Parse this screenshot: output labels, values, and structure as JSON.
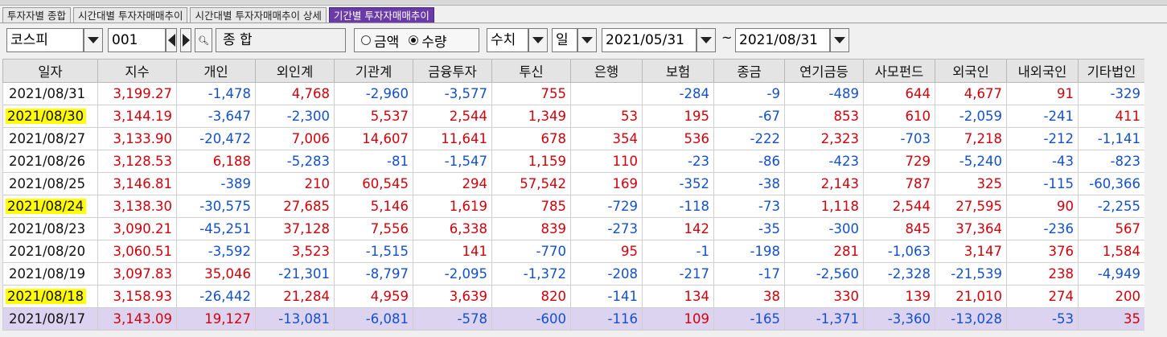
{
  "tabs": [
    {
      "label": "투자자별 종합",
      "active": false
    },
    {
      "label": "시간대별 투자자매매추이",
      "active": false
    },
    {
      "label": "시간대별 투자자매매추이 상세",
      "active": false
    },
    {
      "label": "기간별 투자자매매추이",
      "active": true
    }
  ],
  "controls": {
    "market": "코스피",
    "code": "001",
    "name": "종          합",
    "radio_amount": "금액",
    "radio_qty": "수량",
    "radio_selected": "수량",
    "value_type": "수치",
    "period": "일",
    "date_from": "2021/05/31",
    "tilde": "~",
    "date_to": "2021/08/31"
  },
  "colors": {
    "positive": "#d0000a",
    "negative": "#1450c8",
    "highlight": "#ffff00",
    "selected_row": "#dcd3f0",
    "active_tab": "#6a3aa6"
  },
  "table": {
    "headers": [
      "일자",
      "지수",
      "개인",
      "외인계",
      "기관계",
      "금융투자",
      "투신",
      "은행",
      "보험",
      "종금",
      "연기금등",
      "사모펀드",
      "외국인",
      "내외국인",
      "기타법인"
    ],
    "rows": [
      {
        "date": "2021/08/31",
        "hl": false,
        "sel": false,
        "cells": [
          "3,199.27",
          "-1,478",
          "4,768",
          "-2,960",
          "-3,577",
          "755",
          "",
          "-284",
          "-9",
          "-489",
          "644",
          "4,677",
          "91",
          "-329"
        ]
      },
      {
        "date": "2021/08/30",
        "hl": true,
        "sel": false,
        "cells": [
          "3,144.19",
          "-3,647",
          "-2,300",
          "5,537",
          "2,544",
          "1,349",
          "53",
          "195",
          "-67",
          "853",
          "610",
          "-2,059",
          "-241",
          "411"
        ]
      },
      {
        "date": "2021/08/27",
        "hl": false,
        "sel": false,
        "cells": [
          "3,133.90",
          "-20,472",
          "7,006",
          "14,607",
          "11,641",
          "678",
          "354",
          "536",
          "-222",
          "2,323",
          "-703",
          "7,218",
          "-212",
          "-1,141"
        ]
      },
      {
        "date": "2021/08/26",
        "hl": false,
        "sel": false,
        "cells": [
          "3,128.53",
          "6,188",
          "-5,283",
          "-81",
          "-1,547",
          "1,159",
          "110",
          "-23",
          "-86",
          "-423",
          "729",
          "-5,240",
          "-43",
          "-823"
        ]
      },
      {
        "date": "2021/08/25",
        "hl": false,
        "sel": false,
        "cells": [
          "3,146.81",
          "-389",
          "210",
          "60,545",
          "294",
          "57,542",
          "169",
          "-352",
          "-38",
          "2,143",
          "787",
          "325",
          "-115",
          "-60,366"
        ]
      },
      {
        "date": "2021/08/24",
        "hl": true,
        "sel": false,
        "cells": [
          "3,138.30",
          "-30,575",
          "27,685",
          "5,146",
          "1,619",
          "785",
          "-729",
          "-118",
          "-73",
          "1,118",
          "2,544",
          "27,595",
          "90",
          "-2,255"
        ]
      },
      {
        "date": "2021/08/23",
        "hl": false,
        "sel": false,
        "cells": [
          "3,090.21",
          "-45,251",
          "37,128",
          "7,556",
          "6,338",
          "839",
          "-273",
          "142",
          "-35",
          "-300",
          "845",
          "37,364",
          "-236",
          "567"
        ]
      },
      {
        "date": "2021/08/20",
        "hl": false,
        "sel": false,
        "cells": [
          "3,060.51",
          "-3,592",
          "3,523",
          "-1,515",
          "141",
          "-770",
          "95",
          "-1",
          "-198",
          "281",
          "-1,063",
          "3,147",
          "376",
          "1,584"
        ]
      },
      {
        "date": "2021/08/19",
        "hl": false,
        "sel": false,
        "cells": [
          "3,097.83",
          "35,046",
          "-21,301",
          "-8,797",
          "-2,095",
          "-1,372",
          "-208",
          "-217",
          "-17",
          "-2,560",
          "-2,328",
          "-21,539",
          "238",
          "-4,949"
        ]
      },
      {
        "date": "2021/08/18",
        "hl": true,
        "sel": false,
        "cells": [
          "3,158.93",
          "-26,442",
          "21,284",
          "4,959",
          "3,639",
          "820",
          "-141",
          "134",
          "38",
          "330",
          "139",
          "21,010",
          "274",
          "200"
        ]
      },
      {
        "date": "2021/08/17",
        "hl": false,
        "sel": true,
        "cells": [
          "3,143.09",
          "19,127",
          "-13,081",
          "-6,081",
          "-578",
          "-600",
          "-116",
          "109",
          "-165",
          "-1,371",
          "-3,360",
          "-13,028",
          "-53",
          "35"
        ]
      }
    ]
  }
}
